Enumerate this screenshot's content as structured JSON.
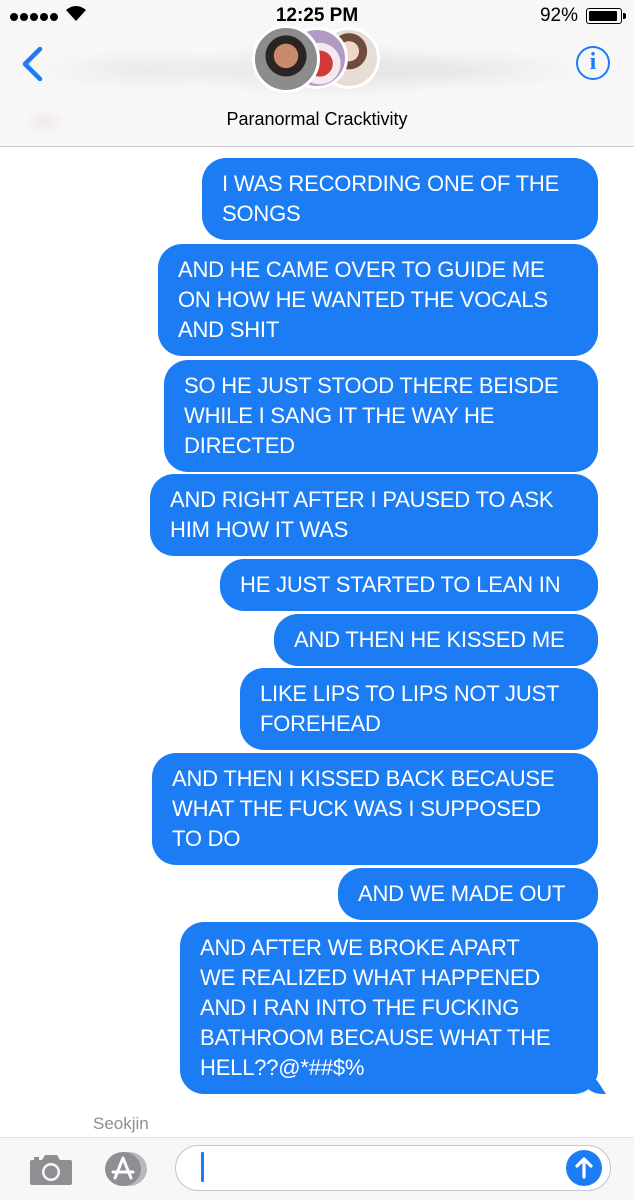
{
  "status_bar": {
    "time": "12:25 PM",
    "battery_percent": "92%",
    "battery_level": 0.92,
    "signal_bars": 5
  },
  "header": {
    "group_name": "Paranormal Cracktivity",
    "back_icon": "chevron-left-icon",
    "info_icon": "info-icon",
    "info_glyph": "i",
    "accent_color": "#1b7cf4"
  },
  "messages": [
    {
      "text": "I WAS RECORDING ONE OF THE\nSONGS",
      "sender": "me"
    },
    {
      "text": "AND HE CAME OVER TO GUIDE ME\nON HOW HE WANTED THE VOCALS\nAND SHIT",
      "sender": "me"
    },
    {
      "text": "SO HE JUST STOOD THERE BEISDE\nWHILE I SANG IT THE WAY HE\nDIRECTED",
      "sender": "me"
    },
    {
      "text": "AND RIGHT AFTER I PAUSED TO ASK\nHIM HOW IT WAS",
      "sender": "me"
    },
    {
      "text": "HE JUST STARTED TO LEAN IN",
      "sender": "me"
    },
    {
      "text": "AND THEN HE KISSED ME",
      "sender": "me"
    },
    {
      "text": "LIKE LIPS TO LIPS NOT JUST\nFOREHEAD",
      "sender": "me"
    },
    {
      "text": "AND THEN I KISSED BACK BECAUSE\nWHAT THE FUCK WAS I SUPPOSED\nTO DO",
      "sender": "me"
    },
    {
      "text": "AND WE MADE OUT",
      "sender": "me"
    },
    {
      "text": "AND AFTER WE BROKE APART\nWE REALIZED WHAT HAPPENED\nAND I RAN INTO THE FUCKING\nBATHROOM BECAUSE WHAT THE\nHELL??@*##$%",
      "sender": "me"
    }
  ],
  "bubble_color": "#1b7cf4",
  "typing_sender_label": "Seokjin",
  "input_bar": {
    "value": "",
    "placeholder": "",
    "camera_icon": "camera-icon",
    "appstore_icon": "app-store-icon",
    "send_icon": "send-arrow-up-icon"
  }
}
